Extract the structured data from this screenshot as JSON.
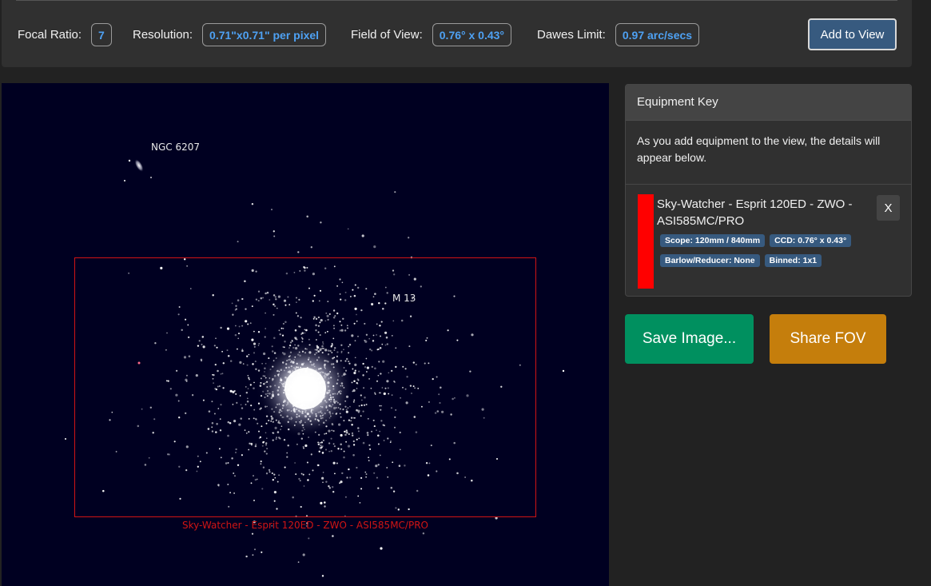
{
  "stats": {
    "focal_ratio_label": "Focal Ratio:",
    "focal_ratio_value": "7",
    "resolution_label": "Resolution:",
    "resolution_value": "0.71\"x0.71\" per pixel",
    "fov_label": "Field of View:",
    "fov_value": "0.76° x 0.43°",
    "dawes_label": "Dawes Limit:",
    "dawes_value": "0.97 arc/secs",
    "add_button": "Add to View"
  },
  "sky": {
    "background_color": "#000021",
    "objects": [
      {
        "name": "NGC 6207"
      },
      {
        "name": "M 13"
      }
    ],
    "fov_overlay": {
      "label": "Sky-Watcher - Esprit 120ED - ZWO - ASI585MC/PRO",
      "color": "#d11414"
    }
  },
  "equipment_key": {
    "title": "Equipment Key",
    "description": "As you add equipment to the view, the details will appear below.",
    "items": [
      {
        "name": "Sky-Watcher - Esprit 120ED - ZWO - ASI585MC/PRO",
        "color": "#ff0000",
        "tags": [
          "Scope: 120mm / 840mm",
          "CCD: 0.76° x 0.43°",
          "Barlow/Reducer: None",
          "Binned: 1x1"
        ],
        "remove_label": "X"
      }
    ]
  },
  "actions": {
    "save_label": "Save Image...",
    "share_label": "Share FOV"
  },
  "colors": {
    "accent_blue": "#375a7f",
    "value_blue": "#4ea1f3",
    "save_green": "#00905f",
    "share_orange": "#c57e0c"
  }
}
